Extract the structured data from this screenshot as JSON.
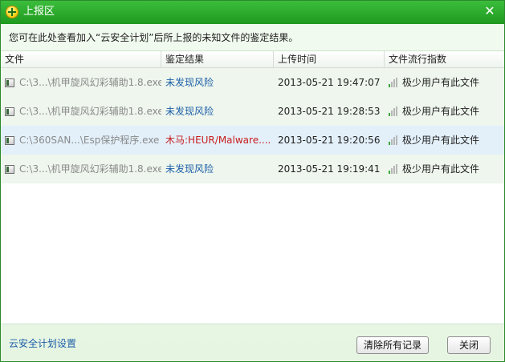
{
  "window": {
    "title": "上报区",
    "close_glyph": "✕"
  },
  "description": "您可在此处查看加入“云安全计划”后所上报的未知文件的鉴定结果。",
  "table": {
    "columns": [
      "文件",
      "鉴定结果",
      "上传时间",
      "文件流行指数"
    ],
    "rows": [
      {
        "file": "C:\\3...\\机甲旋风幻彩辅助1.8.exe",
        "result": "未发现风险",
        "result_status": "safe",
        "time": "2013-05-21 19:47:07",
        "popularity": "极少用户有此文件"
      },
      {
        "file": "C:\\3...\\机甲旋风幻彩辅助1.8.exe",
        "result": "未发现风险",
        "result_status": "safe",
        "time": "2013-05-21 19:28:53",
        "popularity": "极少用户有此文件"
      },
      {
        "file": "C:\\360SAN...\\Esp保护程序.exe",
        "result": "木马:HEUR/Malware....",
        "result_status": "danger",
        "time": "2013-05-21 19:20:56",
        "popularity": "极少用户有此文件"
      },
      {
        "file": "C:\\3...\\机甲旋风幻彩辅助1.8.exe",
        "result": "未发现风险",
        "result_status": "safe",
        "time": "2013-05-21 19:19:41",
        "popularity": "极少用户有此文件"
      }
    ]
  },
  "footer": {
    "settings_link": "云安全计划设置",
    "clear_button": "清除所有记录",
    "close_button": "关闭"
  },
  "icons": {
    "logo": "360-plus-logo-icon",
    "file": "exe-file-icon",
    "popularity": "signal-bars-icon",
    "close": "close-icon"
  },
  "colors": {
    "titlebar": "#22a222",
    "safe": "#1d5fa8",
    "danger": "#c81d1d",
    "link": "#1d5fa8"
  }
}
